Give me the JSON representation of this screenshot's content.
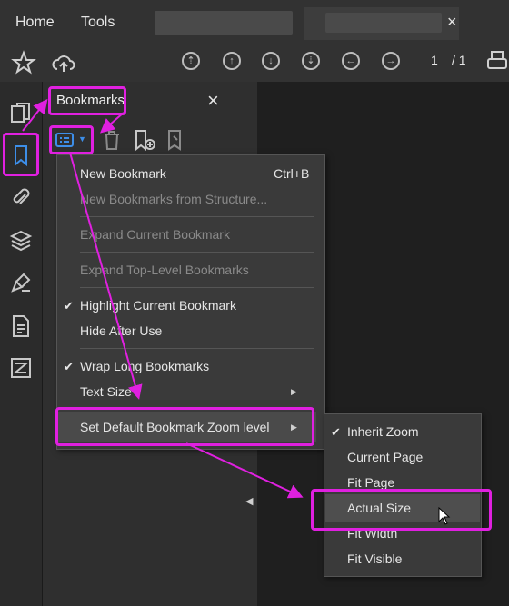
{
  "menubar": {
    "items": [
      {
        "label": "Home"
      },
      {
        "label": "Tools"
      }
    ],
    "tab_close": "×"
  },
  "toolbar": {
    "current_page": "1",
    "page_total": "/ 1"
  },
  "panel": {
    "title": "Bookmarks",
    "close": "×",
    "collapse_glyph": "◀"
  },
  "options_menu": {
    "items": [
      {
        "label": "New Bookmark",
        "shortcut": "Ctrl+B",
        "enabled": true,
        "checked": false
      },
      {
        "label": "New Bookmarks from Structure...",
        "enabled": false,
        "checked": false
      },
      {
        "label": "Expand Current Bookmark",
        "enabled": false,
        "checked": false
      },
      {
        "label": "Expand Top-Level Bookmarks",
        "enabled": false,
        "checked": false
      },
      {
        "label": "Highlight Current Bookmark",
        "enabled": true,
        "checked": true
      },
      {
        "label": "Hide After Use",
        "enabled": true,
        "checked": false
      },
      {
        "label": "Wrap Long Bookmarks",
        "enabled": true,
        "checked": true
      },
      {
        "label": "Text Size",
        "enabled": true,
        "checked": false,
        "submenu": true
      },
      {
        "label": "Set Default Bookmark Zoom level",
        "enabled": true,
        "checked": false,
        "submenu": true
      }
    ],
    "check_glyph": "✔",
    "submenu_glyph": "▶"
  },
  "zoom_submenu": {
    "items": [
      {
        "label": "Inherit Zoom",
        "checked": true
      },
      {
        "label": "Current Page",
        "checked": false
      },
      {
        "label": "Fit Page",
        "checked": false
      },
      {
        "label": "Actual Size",
        "checked": false,
        "hovered": true
      },
      {
        "label": "Fit Width",
        "checked": false
      },
      {
        "label": "Fit Visible",
        "checked": false
      }
    ]
  },
  "colors": {
    "annotation": "#e020e0",
    "bookmark_accent": "#3d8ee8"
  }
}
